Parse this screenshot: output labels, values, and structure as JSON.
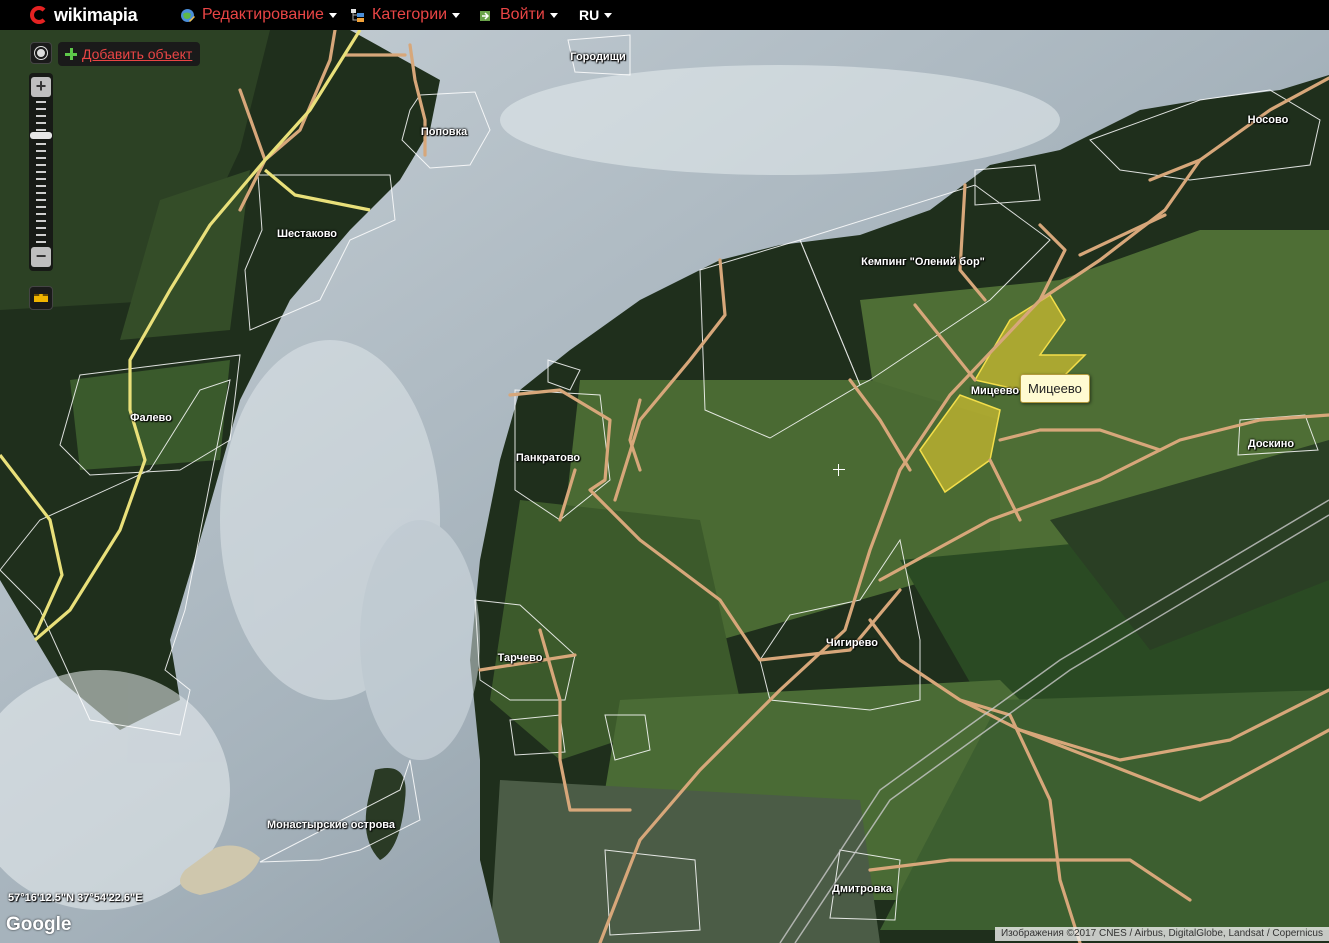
{
  "topbar": {
    "logo_text": "wikimapia",
    "menu_edit": "Редактирование",
    "menu_categories": "Категории",
    "menu_login": "Войти",
    "lang": "RU"
  },
  "controls": {
    "add_object": "Добавить объект",
    "zoom_in": "+",
    "zoom_out": "−",
    "zoom_level_fraction": 0.22
  },
  "places": [
    {
      "key": "gorodischi",
      "name": "Городищи"
    },
    {
      "key": "popovka",
      "name": "Поповка"
    },
    {
      "key": "nosovo",
      "name": "Носово"
    },
    {
      "key": "shestakovo",
      "name": "Шестаково"
    },
    {
      "key": "camping",
      "name": "Кемпинг \"Олений бор\""
    },
    {
      "key": "mitseevo",
      "name": "Мицеево"
    },
    {
      "key": "falevo",
      "name": "Фалево"
    },
    {
      "key": "doskino",
      "name": "Доскино"
    },
    {
      "key": "pankratovo",
      "name": "Панкратово"
    },
    {
      "key": "chigirevo",
      "name": "Чигирево"
    },
    {
      "key": "tarchevo",
      "name": "Тарчево"
    },
    {
      "key": "monastyrskie",
      "name": "Монастырские острова"
    },
    {
      "key": "dmitrovka",
      "name": "Дмитровка"
    }
  ],
  "tooltip": "Мицеево",
  "coordinates": "57°16'12.5\"N 37°54'22.6\"E",
  "google_logo": "Google",
  "attribution": "Изображения ©2017 CNES / Airbus, DigitalGlobe, Landsat / Copernicus",
  "colors": {
    "brand_red": "#e52222",
    "menu_red": "#e94545",
    "road": "#d7a77a",
    "highway": "#e9e07a",
    "highlight": "#e8cd2f"
  }
}
